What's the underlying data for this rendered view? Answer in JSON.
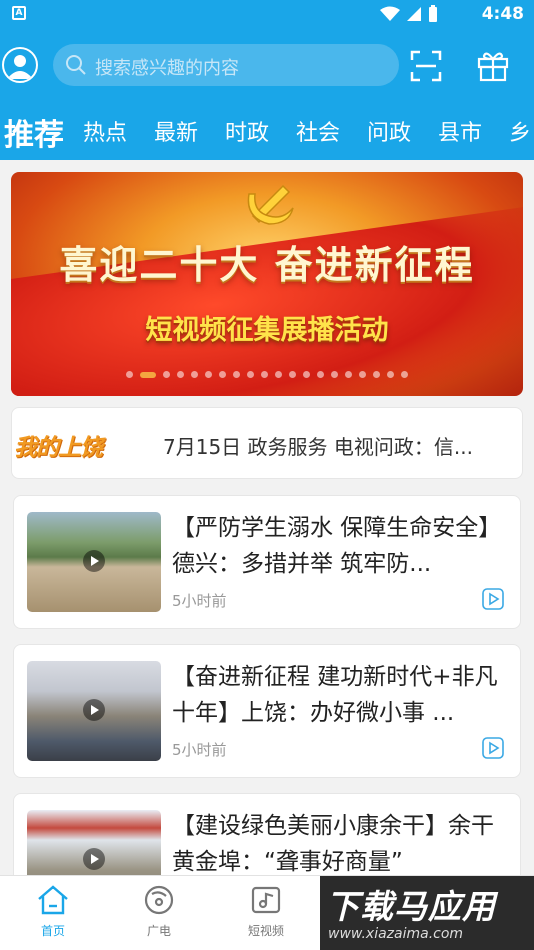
{
  "status_bar": {
    "app_badge": "A",
    "time": "4:48",
    "icons": [
      "wifi-icon",
      "signal-icon",
      "battery-icon"
    ]
  },
  "header": {
    "search_placeholder": "搜索感兴趣的内容",
    "icons": [
      "avatar-icon",
      "search-icon",
      "scan-icon",
      "gift-icon"
    ]
  },
  "tabs": [
    {
      "label": "推荐",
      "active": true
    },
    {
      "label": "热点"
    },
    {
      "label": "最新"
    },
    {
      "label": "时政"
    },
    {
      "label": "社会"
    },
    {
      "label": "问政"
    },
    {
      "label": "县市"
    },
    {
      "label": "乡"
    }
  ],
  "banner": {
    "headline": "喜迎二十大 奋进新征程",
    "subline": "短视频征集展播活动",
    "slide_count": 20,
    "active_slide": 1
  },
  "ticker": {
    "logo": "我的上饶",
    "text": "7月15日 政务服务 电视问政：信..."
  },
  "news": [
    {
      "title": "【严防学生溺水 保障生命安全】德兴：多措并举 筑牢防...",
      "time": "5小时前"
    },
    {
      "title": "【奋进新征程 建功新时代+非凡十年】上饶：办好微小事 ...",
      "time": "5小时前"
    },
    {
      "title": "【建设绿色美丽小康余干】余干黄金埠：“聋事好商量”",
      "time": ""
    }
  ],
  "bottom_nav": [
    {
      "label": "首页",
      "active": true
    },
    {
      "label": "广电"
    },
    {
      "label": "短视频"
    }
  ],
  "watermark": {
    "big": "下载马应用",
    "small": "www.xiazaima.com"
  },
  "colors": {
    "brand_blue": "#1aa6e8",
    "banner_red": "#d21e14",
    "banner_gold": "#ffe34a"
  }
}
